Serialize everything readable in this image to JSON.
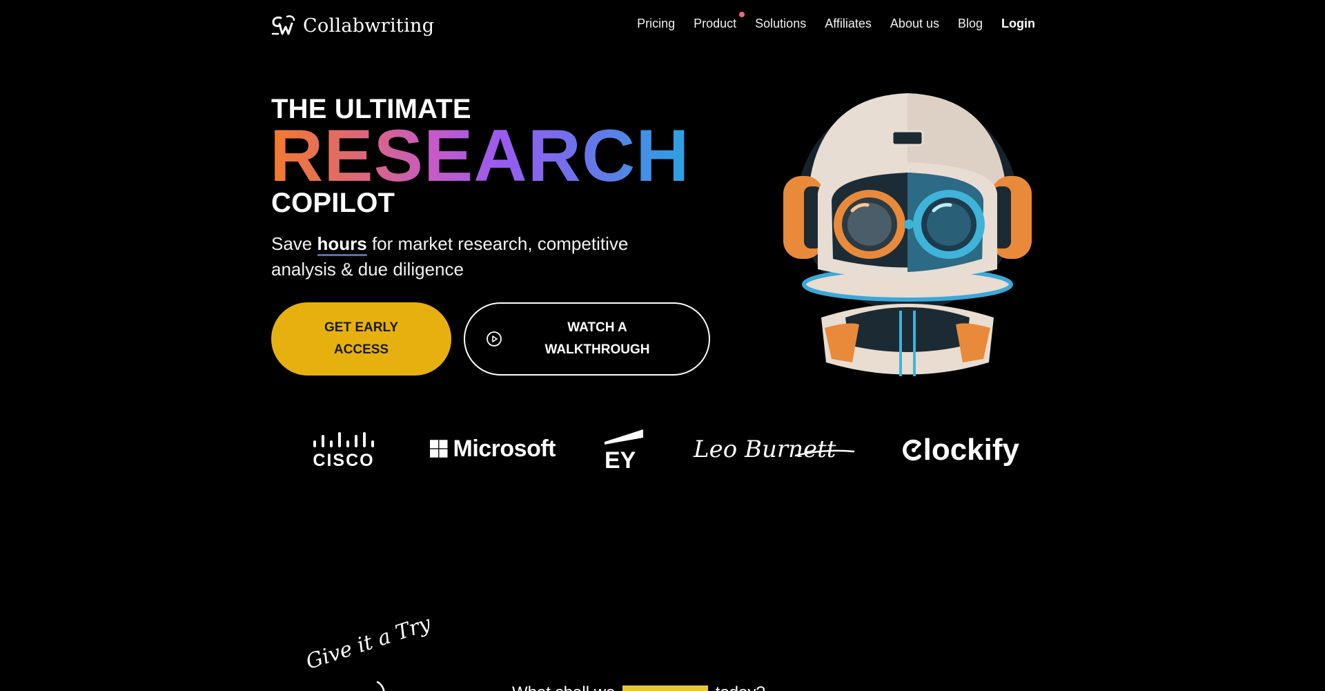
{
  "brand": {
    "name": "Collabwriting",
    "logo_icon": "cw-logo-icon"
  },
  "nav": {
    "items": [
      {
        "label": "Pricing"
      },
      {
        "label": "Product"
      },
      {
        "label": "Solutions"
      },
      {
        "label": "Affiliates"
      },
      {
        "label": "About us"
      },
      {
        "label": "Blog"
      },
      {
        "label": "Login"
      }
    ],
    "badge_color": "#f06292"
  },
  "hero": {
    "line1": "THE ULTIMATE",
    "line2": "RESEARCH",
    "line3": "COPILOT",
    "subtitle_before": "Save ",
    "subtitle_highlight": "hours",
    "subtitle_after": " for market research, competitive analysis & due diligence",
    "gradient_colors": [
      "#f47b2c",
      "#e06a6a",
      "#c75bc4",
      "#9a5bf0",
      "#6a74ea",
      "#2aa4e0"
    ],
    "primary_button": {
      "line1": "GET EARLY",
      "line2": "ACCESS",
      "color": "#e6b10f"
    },
    "secondary_button": {
      "line1": "WATCH A",
      "line2": "WALKTHROUGH",
      "icon": "play-circle-icon"
    },
    "illustration": "astronaut-robot-illustration"
  },
  "logos": [
    {
      "name": "cisco",
      "text": "CISCO"
    },
    {
      "name": "microsoft",
      "text": "Microsoft"
    },
    {
      "name": "ey",
      "text": "EY"
    },
    {
      "name": "leo-burnett",
      "text": "Leo Burnett"
    },
    {
      "name": "clockify",
      "text": "lockify"
    }
  ],
  "bottom": {
    "handwritten": "Give it a Try",
    "line_before": "What shall we",
    "line_after": "today?"
  }
}
